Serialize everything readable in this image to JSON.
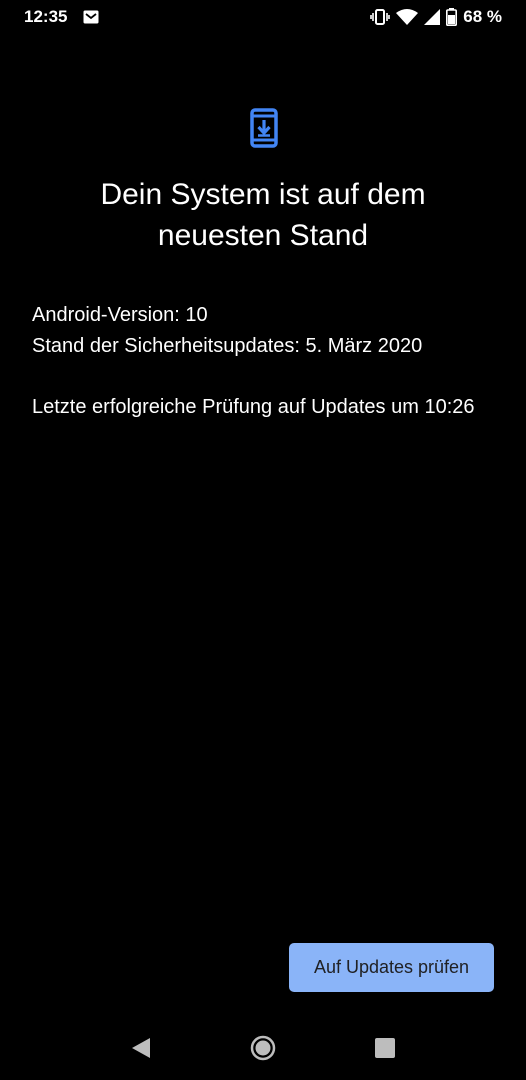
{
  "status_bar": {
    "time": "12:35",
    "battery": "68 %"
  },
  "icons": {
    "notification": "gmail-icon",
    "vibrate": "vibrate-icon",
    "wifi": "wifi-icon",
    "signal": "signal-icon",
    "battery": "battery-icon",
    "hero": "system-update-icon"
  },
  "update": {
    "title": "Dein System ist auf dem neuesten Stand",
    "android_version": "Android-Version: 10",
    "security_patch": "Stand der Sicherheitsupdates: 5. März 2020",
    "last_check": "Letzte erfolgreiche Prüfung auf Updates um 10:26",
    "button_label": "Auf Updates prüfen"
  },
  "colors": {
    "background": "#000000",
    "accent": "#8ab4f8",
    "icon_blue": "#4285f4",
    "button_text": "#202124"
  }
}
